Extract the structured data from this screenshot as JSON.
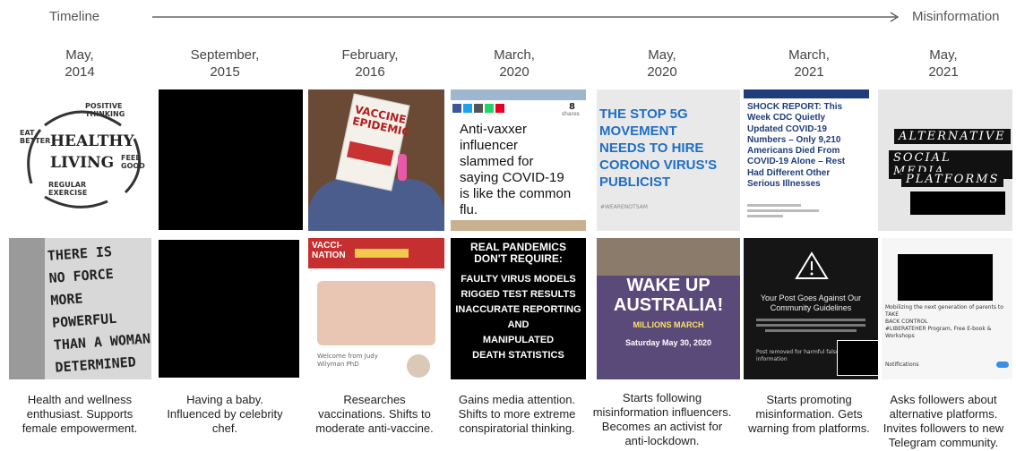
{
  "header": {
    "left_label": "Timeline",
    "right_label": "Misinformation"
  },
  "columns": [
    {
      "date": "May,\n2014",
      "caption": "Health and wellness\nenthusiast. Supports\nfemale empowerment."
    },
    {
      "date": "September,\n2015",
      "caption": "Having a baby.\nInfluenced by celebrity\nchef."
    },
    {
      "date": "February,\n2016",
      "caption": "Researches\nvaccinations. Shifts to\nmoderate anti-vaccine."
    },
    {
      "date": "March,\n2020",
      "caption": "Gains media attention.\nShifts to more extreme\nconspiratorial thinking."
    },
    {
      "date": "May,\n2020",
      "caption": "Starts following\nmisinformation influencers.\nBecomes an activist for\nanti-lockdown."
    },
    {
      "date": "March,\n2021",
      "caption": "Starts promoting\nmisinformation. Gets\nwarning from platforms."
    },
    {
      "date": "May,\n2021",
      "caption": "Asks followers about\nalternative platforms.\nInvites followers to new\nTelegram community."
    }
  ],
  "images": {
    "healthy_living": {
      "center": "HEALTHY\nLIVING",
      "w1": "POSITIVE\nTHINKING",
      "w2": "FEEL\nGOOD",
      "w3": "REGULAR\nEXERCISE",
      "w4": "EAT\nBETTER"
    },
    "vaccine_book": "VACCINE\nEPIDEMIC",
    "anti_vaxxer": {
      "shares": "8",
      "shares_label": "shares",
      "headline": "Anti-vaxxer\ninfluencer\nslammed for\nsaying COVID-19\nis like the common\nflu."
    },
    "stop_5g": {
      "text": "THE STOP 5G\nMOVEMENT\nNEEDS TO HIRE\nCORONO VIRUS'S\nPUBLICIST",
      "tag": "#WEARENOTSAM"
    },
    "shock_report": {
      "text": "SHOCK REPORT: This\nWeek CDC Quietly\nUpdated COVID-19\nNumbers – Only 9,210\nAmericans Died From\nCOVID-19 Alone – Rest\nHad Different Other\nSerious Illnesses"
    },
    "alt_platforms": {
      "line1": "ALTERNATIVE",
      "line2": "SOCIAL MEDIA",
      "line3": "PLATFORMS"
    },
    "no_force": "THERE IS\nNO FORCE\nMORE POWERFUL\nTHAN A WOMAN\nDETERMINED\nTO RISE",
    "vacci_nation": {
      "banner": "VACCI-\nNATION",
      "welcome": "Welcome from Judy\nWilyman PhD"
    },
    "real_pandemics": {
      "title": "REAL PANDEMICS\nDON'T REQUIRE:",
      "body": "FAULTY VIRUS MODELS\nRIGGED TEST RESULTS\nINACCURATE REPORTING\nAND\nMANIPULATED\nDEATH STATISTICS"
    },
    "wake_up": {
      "title": "WAKE UP\nAUSTRALIA!",
      "sub": "MILLIONS MARCH",
      "date": "Saturday May 30, 2020"
    },
    "guidelines": {
      "title": "Your Post Goes Against Our\nCommunity Guidelines",
      "note": "Post removed for harmful false\ninformation"
    },
    "telegram": {
      "text": "Mobilizing the next generation of parents to TAKE\nBACK CONTROL\n#LIBERATEHER Program, Free E-book & Workshops",
      "notif": "Notifications"
    }
  }
}
